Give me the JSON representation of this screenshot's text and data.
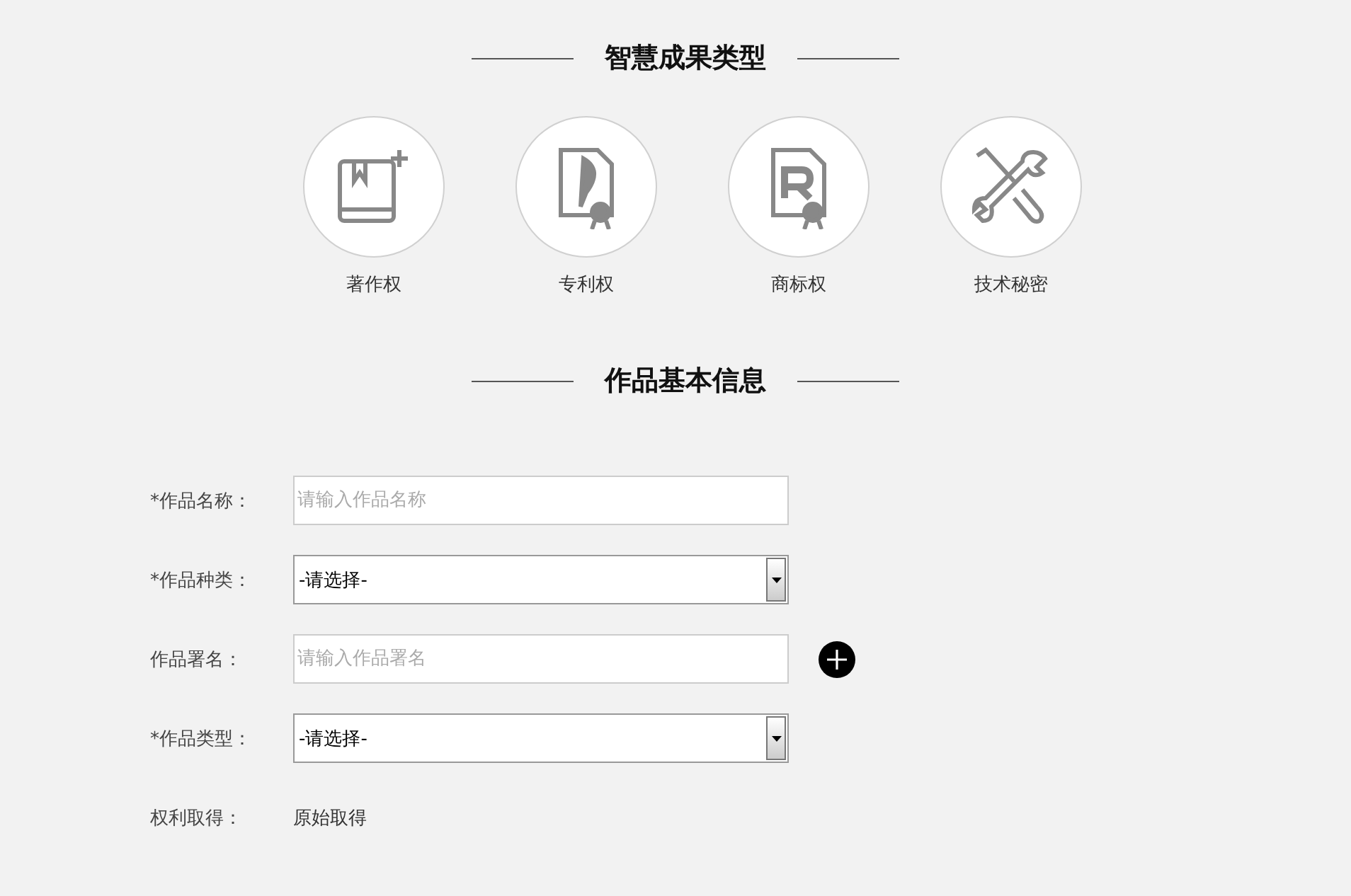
{
  "types_section": {
    "title": "智慧成果类型",
    "items": [
      {
        "kind": "copyright",
        "label": "著作权"
      },
      {
        "kind": "patent",
        "label": "专利权"
      },
      {
        "kind": "trademark",
        "label": "商标权"
      },
      {
        "kind": "secret",
        "label": "技术秘密"
      }
    ]
  },
  "info_section": {
    "title": "作品基本信息",
    "fields": [
      {
        "kind": "input",
        "label": "*作品名称：",
        "placeholder": "请输入作品名称",
        "add_button": false
      },
      {
        "kind": "select",
        "label": "*作品种类：",
        "value": "-请选择-",
        "add_button": false
      },
      {
        "kind": "input",
        "label": "作品署名：",
        "placeholder": "请输入作品署名",
        "add_button": true
      },
      {
        "kind": "select",
        "label": "*作品类型：",
        "value": "-请选择-",
        "add_button": false
      },
      {
        "kind": "static",
        "label": "权利取得：",
        "value": "原始取得",
        "add_button": false
      }
    ]
  }
}
